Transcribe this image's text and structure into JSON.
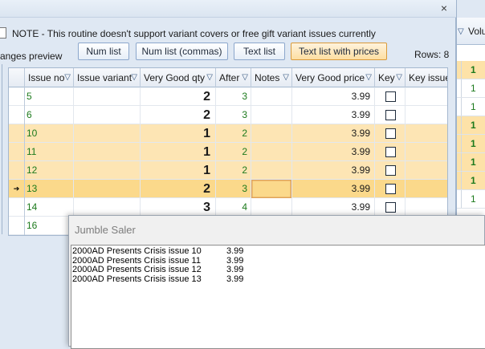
{
  "main": {
    "close_glyph": "×",
    "notice": "NOTE - This routine doesn't support variant covers or free gift variant issues currently",
    "preview_label": "anges preview",
    "buttons": [
      {
        "label": "Num list"
      },
      {
        "label": "Num list (commas)"
      },
      {
        "label": "Text list"
      },
      {
        "label": "Text list with prices",
        "active": true
      }
    ],
    "rows_count": "Rows: 8"
  },
  "grid": {
    "columns": [
      "Issue no",
      "Issue variant",
      "Very Good qty",
      "After",
      "Notes",
      "Very Good price",
      "Key",
      "Key issue"
    ],
    "current_row_marker": "➔",
    "rows": [
      {
        "issue_no": "5",
        "qty": "2",
        "after": "3",
        "price": "3.99",
        "highlight": false
      },
      {
        "issue_no": "6",
        "qty": "2",
        "after": "3",
        "price": "3.99",
        "highlight": false
      },
      {
        "issue_no": "10",
        "qty": "1",
        "after": "2",
        "price": "3.99",
        "highlight": true
      },
      {
        "issue_no": "11",
        "qty": "1",
        "after": "2",
        "price": "3.99",
        "highlight": true
      },
      {
        "issue_no": "12",
        "qty": "1",
        "after": "2",
        "price": "3.99",
        "highlight": true
      },
      {
        "issue_no": "13",
        "qty": "2",
        "after": "3",
        "price": "3.99",
        "highlight": true,
        "current": true
      },
      {
        "issue_no": "14",
        "qty": "3",
        "after": "4",
        "price": "3.99",
        "highlight": false
      },
      {
        "issue_no": "16",
        "qty": "",
        "after": "",
        "price": "",
        "highlight": false
      }
    ]
  },
  "background_window": {
    "column_label": "Volu",
    "values": [
      "1",
      "1",
      "1",
      "1",
      "1",
      "1",
      "1",
      "1"
    ]
  },
  "jumble": {
    "title": "Jumble Saler",
    "lines": [
      {
        "name": "2000AD Presents Crisis issue 10",
        "price": "3.99"
      },
      {
        "name": "2000AD Presents Crisis issue 11",
        "price": "3.99"
      },
      {
        "name": "2000AD Presents Crisis issue 12",
        "price": "3.99"
      },
      {
        "name": "2000AD Presents Crisis issue 13",
        "price": "3.99"
      }
    ]
  }
}
